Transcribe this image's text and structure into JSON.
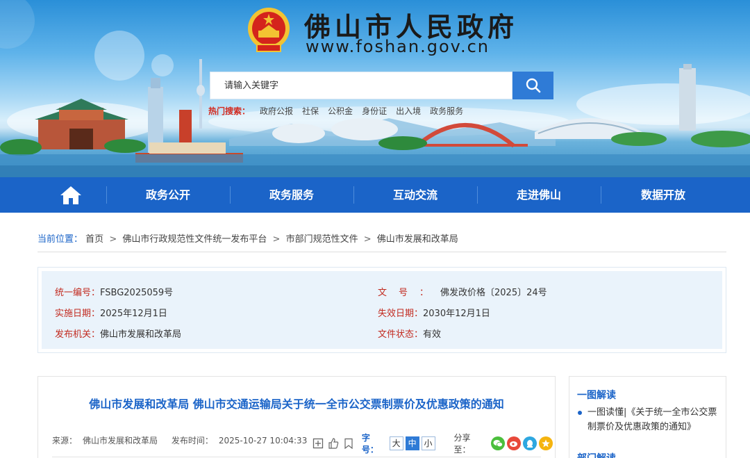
{
  "header": {
    "site_title": "佛山市人民政府",
    "site_url": "www.foshan.gov.cn",
    "search_placeholder": "请输入关键字",
    "hot_label": "热门搜索：",
    "hot_keywords": [
      "政府公报",
      "社保",
      "公积金",
      "身份证",
      "出入境",
      "政务服务"
    ]
  },
  "nav": {
    "items": [
      "政务公开",
      "政务服务",
      "互动交流",
      "走进佛山",
      "数据开放"
    ]
  },
  "breadcrumb": {
    "label": "当前位置：",
    "items": [
      "首页",
      "佛山市行政规范性文件统一发布平台",
      "市部门规范性文件",
      "佛山市发展和改革局"
    ],
    "separator": ">"
  },
  "meta": {
    "serial_label": "统一编号：",
    "serial_value": "FSBG2025059号",
    "doc_label": "文号：",
    "doc_value": "佛发改价格〔2025〕24号",
    "effective_label": "实施日期：",
    "effective_value": "2025年12月1日",
    "expire_label": "失效日期：",
    "expire_value": "2030年12月1日",
    "issuer_label": "发布机关：",
    "issuer_value": "佛山市发展和改革局",
    "status_label": "文件状态：",
    "status_value": "有效"
  },
  "article": {
    "title": "佛山市发展和改革局 佛山市交通运输局关于统一全市公交票制票价及优惠政策的通知",
    "source_label": "来源：",
    "source_value": "佛山市发展和改革局",
    "time_label": "发布时间：",
    "time_value": "2025-10-27 10:04:33",
    "font_size_label": "字号：",
    "font_sizes": [
      "大",
      "中",
      "小"
    ],
    "active_font_size": "中",
    "share_label": "分享至："
  },
  "sidebar": {
    "heading1": "一图解读",
    "item1": "一图读懂|《关于统一全市公交票制票价及优惠政策的通知》",
    "heading2": "部门解读"
  },
  "colors": {
    "primary": "#1b64c8",
    "accent_red": "#c22a1f",
    "meta_bg": "#eaf3fb",
    "search_btn": "#2f7bd6"
  },
  "icons": {
    "search": "search-icon",
    "home": "home-icon",
    "share": [
      "wechat-icon",
      "weibo-icon",
      "qq-icon",
      "qzone-icon"
    ]
  }
}
